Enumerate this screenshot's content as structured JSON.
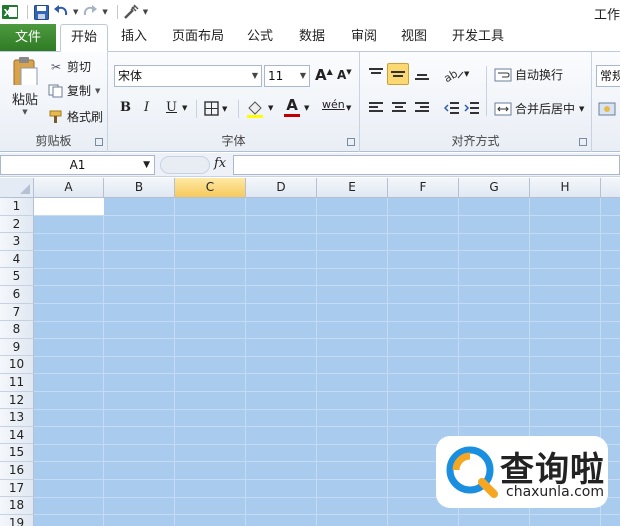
{
  "titlebar": {
    "doc_title": "工作",
    "quick_access": [
      "excel-logo-icon",
      "save-icon",
      "undo-icon",
      "redo-icon",
      "customize-icon"
    ]
  },
  "tabs": {
    "file": "文件",
    "items": [
      "开始",
      "插入",
      "页面布局",
      "公式",
      "数据",
      "审阅",
      "视图",
      "开发工具"
    ],
    "active": "开始"
  },
  "ribbon": {
    "clipboard": {
      "label": "剪贴板",
      "paste": "粘贴",
      "cut": "剪切",
      "copy": "复制",
      "format_painter": "格式刷"
    },
    "font": {
      "label": "字体",
      "font_name": "宋体",
      "font_size": "11",
      "bold": "B",
      "italic": "I",
      "underline": "U",
      "grow": "A",
      "shrink": "A",
      "font_color_letter": "A",
      "phonetic": "wén"
    },
    "alignment": {
      "label": "对齐方式",
      "wrap_text": "自动换行",
      "merge_center": "合并后居中"
    },
    "number": {
      "format": "常规"
    }
  },
  "formula_bar": {
    "name_box": "A1",
    "fx": "fx",
    "value": ""
  },
  "grid": {
    "columns": [
      "A",
      "B",
      "C",
      "D",
      "E",
      "F",
      "G",
      "H"
    ],
    "selected_column": "C",
    "rows": [
      "1",
      "2",
      "3",
      "4",
      "5",
      "6",
      "7",
      "8",
      "9",
      "10",
      "11",
      "12",
      "13",
      "14",
      "15",
      "16",
      "17",
      "18",
      "19"
    ]
  },
  "watermark": {
    "cn": "查询啦",
    "en": "chaxunla.com"
  },
  "colors": {
    "file_tab": "#2f7b25",
    "selection": "#a9cbee",
    "selected_header": "#f7c95b",
    "watermark_accent": "#1a8fe0"
  }
}
